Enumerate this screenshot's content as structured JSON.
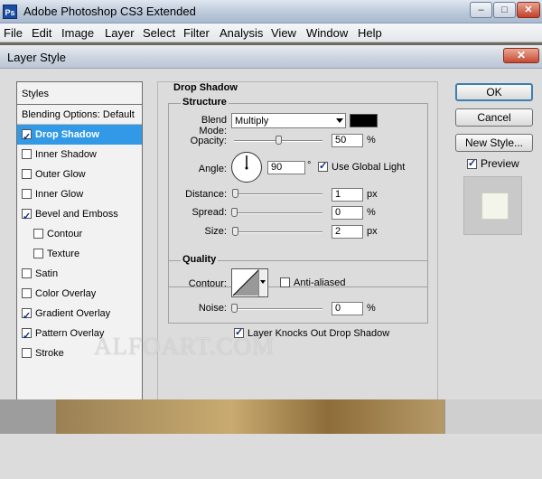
{
  "app": {
    "icon_text": "Ps",
    "title": "Adobe Photoshop CS3 Extended",
    "window_controls": {
      "minimize": "–",
      "maximize": "□",
      "close": "✕"
    }
  },
  "menu": [
    "File",
    "Edit",
    "Image",
    "Layer",
    "Select",
    "Filter",
    "Analysis",
    "View",
    "Window",
    "Help"
  ],
  "dialog": {
    "title": "Layer Style",
    "close": "✕",
    "styles_header": "Styles",
    "styles": [
      {
        "label": "Blending Options: Default",
        "checkbox": false,
        "checked": false,
        "selected": false
      },
      {
        "label": "Drop Shadow",
        "checkbox": true,
        "checked": true,
        "selected": true
      },
      {
        "label": "Inner Shadow",
        "checkbox": true,
        "checked": false,
        "selected": false
      },
      {
        "label": "Outer Glow",
        "checkbox": true,
        "checked": false,
        "selected": false
      },
      {
        "label": "Inner Glow",
        "checkbox": true,
        "checked": false,
        "selected": false
      },
      {
        "label": "Bevel and Emboss",
        "checkbox": true,
        "checked": true,
        "selected": false
      },
      {
        "label": "Contour",
        "checkbox": true,
        "checked": false,
        "selected": false,
        "sub": true
      },
      {
        "label": "Texture",
        "checkbox": true,
        "checked": false,
        "selected": false,
        "sub": true
      },
      {
        "label": "Satin",
        "checkbox": true,
        "checked": false,
        "selected": false
      },
      {
        "label": "Color Overlay",
        "checkbox": true,
        "checked": false,
        "selected": false
      },
      {
        "label": "Gradient Overlay",
        "checkbox": true,
        "checked": true,
        "selected": false
      },
      {
        "label": "Pattern Overlay",
        "checkbox": true,
        "checked": true,
        "selected": false
      },
      {
        "label": "Stroke",
        "checkbox": true,
        "checked": false,
        "selected": false
      }
    ],
    "section_title": "Drop Shadow",
    "structure": {
      "title": "Structure",
      "blend_mode_label": "Blend Mode:",
      "blend_mode_value": "Multiply",
      "shadow_color": "#000000",
      "opacity_label": "Opacity:",
      "opacity_value": "50",
      "opacity_unit": "%",
      "angle_label": "Angle:",
      "angle_value": "90",
      "angle_unit": "°",
      "use_global_light_label": "Use Global Light",
      "use_global_light": true,
      "distance_label": "Distance:",
      "distance_value": "1",
      "distance_unit": "px",
      "spread_label": "Spread:",
      "spread_value": "0",
      "spread_unit": "%",
      "size_label": "Size:",
      "size_value": "2",
      "size_unit": "px"
    },
    "quality": {
      "title": "Quality",
      "contour_label": "Contour:",
      "anti_aliased_label": "Anti-aliased",
      "anti_aliased": false,
      "noise_label": "Noise:",
      "noise_value": "0",
      "noise_unit": "%"
    },
    "knockout_label": "Layer Knocks Out Drop Shadow",
    "knockout": true,
    "buttons": {
      "ok": "OK",
      "cancel": "Cancel",
      "new_style": "New Style..."
    },
    "preview_label": "Preview",
    "preview_checked": true
  },
  "watermark": "ALFOART.COM"
}
